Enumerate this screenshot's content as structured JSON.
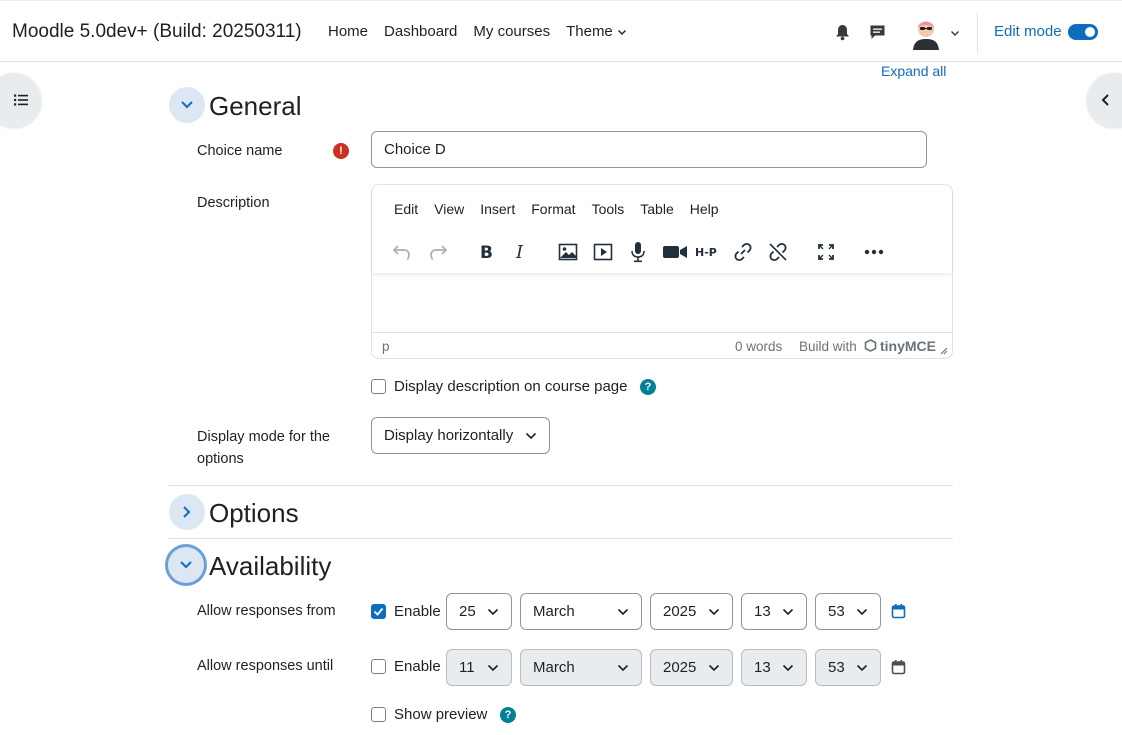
{
  "navbar": {
    "site_name": "Moodle 5.0dev+ (Build: 20250311)",
    "links": [
      "Home",
      "Dashboard",
      "My courses",
      "Theme"
    ],
    "edit_mode_label": "Edit mode"
  },
  "expand_all": "Expand all",
  "general": {
    "title": "General",
    "choice_name_label": "Choice name",
    "choice_name_value": "Choice D",
    "description_label": "Description",
    "editor": {
      "menu": [
        "Edit",
        "View",
        "Insert",
        "Format",
        "Tools",
        "Table",
        "Help"
      ],
      "status_path": "p",
      "word_count": "0 words",
      "build_with": "Build with",
      "brand": "tinyMCE"
    },
    "display_description_label": "Display description on course page",
    "display_mode_label": "Display mode for the options",
    "display_mode_value": "Display horizontally"
  },
  "options": {
    "title": "Options"
  },
  "availability": {
    "title": "Availability",
    "from_label": "Allow responses from",
    "until_label": "Allow responses until",
    "enable_label": "Enable",
    "from": {
      "day": "25",
      "month": "March",
      "year": "2025",
      "hour": "13",
      "minute": "53",
      "enabled": true
    },
    "until": {
      "day": "11",
      "month": "March",
      "year": "2025",
      "hour": "13",
      "minute": "53",
      "enabled": false
    },
    "show_preview_label": "Show preview"
  },
  "colors": {
    "primary": "#0f6cbf",
    "required": "#ca3120",
    "help": "#008196"
  }
}
